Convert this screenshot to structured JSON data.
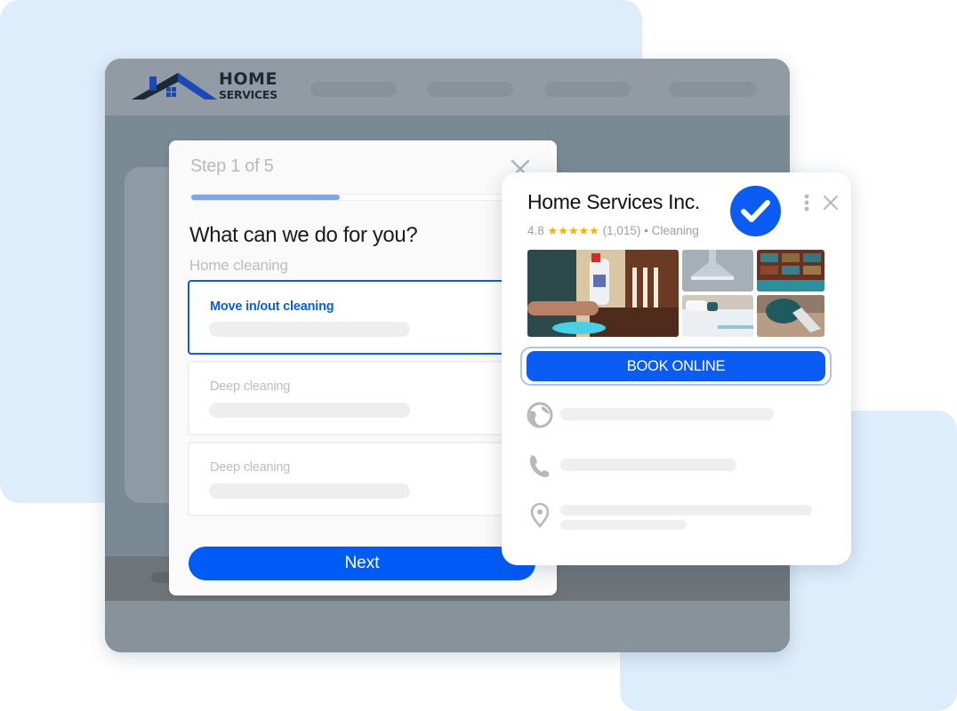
{
  "logo": {
    "line1": "HOME",
    "line2": "SERVICES",
    "colors": {
      "roof_dark": "#1b2836",
      "roof_blue": "#1c49b8"
    }
  },
  "nav": {
    "placeholder_count": 4
  },
  "wizard": {
    "step_label": "Step 1 of 5",
    "progress_fraction": 0.43,
    "question": "What can we do for you?",
    "category": "Home cleaning",
    "options": [
      {
        "label": "Move in/out cleaning",
        "selected": true
      },
      {
        "label": "Deep cleaning",
        "selected": false
      },
      {
        "label": "Deep cleaning",
        "selected": false
      }
    ],
    "next_label": "Next",
    "close_icon": "close-icon"
  },
  "business": {
    "name": "Home Services Inc.",
    "rating": "4.8",
    "stars": "★★★★★",
    "review_count": "(1,015)",
    "separator": "•",
    "category": "Cleaning",
    "verified": true,
    "photos": [
      "person-spraying-cleaner-photo",
      "carpet-cleaner-nozzle-photo",
      "bookshelf-room-photo",
      "bed-linens-photo",
      "carpet-scrubbing-photo"
    ],
    "book_label": "BOOK ONLINE",
    "info_rows": [
      {
        "icon": "globe-icon"
      },
      {
        "icon": "phone-icon"
      },
      {
        "icon": "location-pin-icon"
      }
    ]
  },
  "colors": {
    "primary_blue": "#005bf6",
    "progress_blue": "#7da4ef",
    "star_gold": "#f4b400",
    "background_blue": "#deedfc"
  }
}
